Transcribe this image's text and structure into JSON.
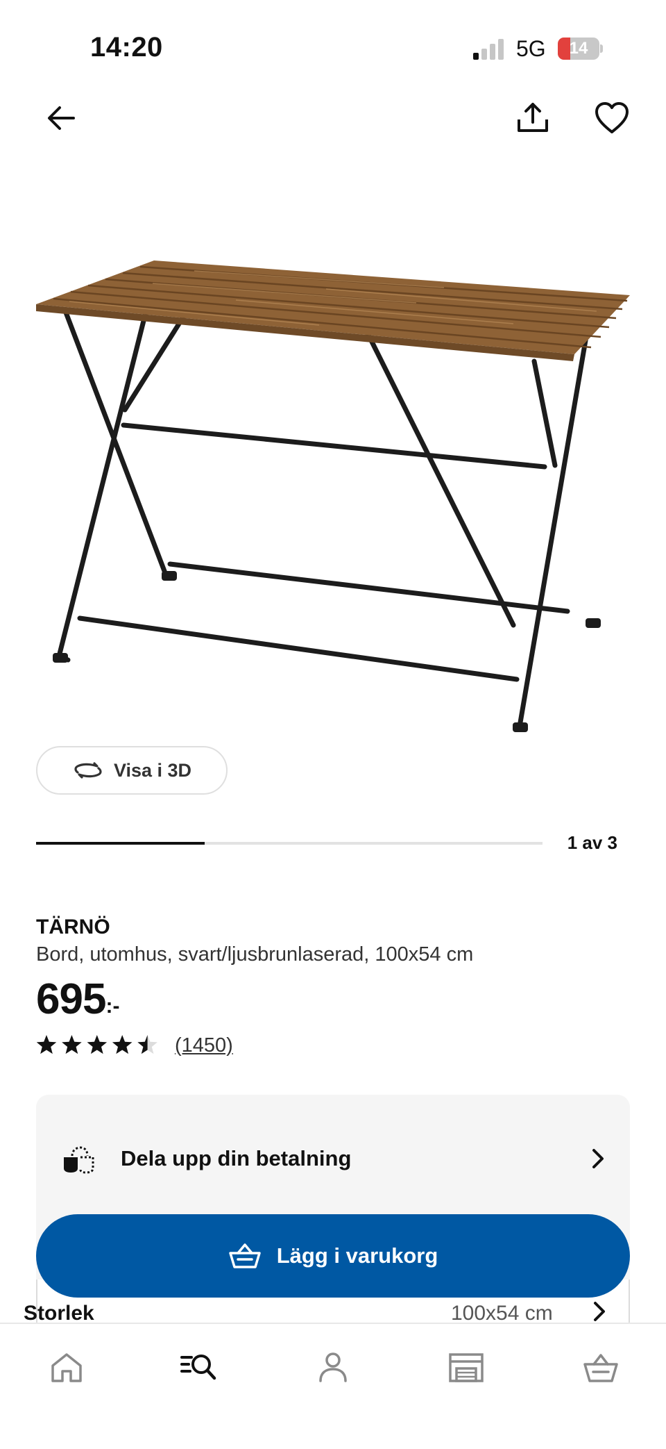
{
  "status_bar": {
    "time": "14:20",
    "network": "5G",
    "battery_level": "14"
  },
  "top_nav": {
    "back_icon": "arrow-left-icon",
    "share_icon": "share-icon",
    "favorite_icon": "heart-icon"
  },
  "product": {
    "image_icon": "folding-table-image",
    "view_3d_label": "Visa i 3D",
    "gallery_position": 1,
    "gallery_total": 3,
    "gallery_counter": "1 av 3",
    "name": "TÄRNÖ",
    "description": "Bord, utomhus, svart/ljusbrunlaserad, 100x54 cm",
    "price": "695",
    "price_suffix": ":-",
    "rating": 4.5,
    "rating_max": 5,
    "review_count": "(1450)"
  },
  "options": {
    "payment_label": "Dela upp din betalning",
    "size_label": "Storlek",
    "size_value": "100x54 cm"
  },
  "cart_button": {
    "label": "Lägg i varukorg"
  },
  "bottom_nav": {
    "items": [
      {
        "icon": "home-icon"
      },
      {
        "icon": "search-icon"
      },
      {
        "icon": "user-icon"
      },
      {
        "icon": "store-icon"
      },
      {
        "icon": "basket-icon"
      }
    ]
  },
  "colors": {
    "primary": "#0058a3",
    "battery_low": "#e2413d",
    "wood": "#a3774a"
  }
}
